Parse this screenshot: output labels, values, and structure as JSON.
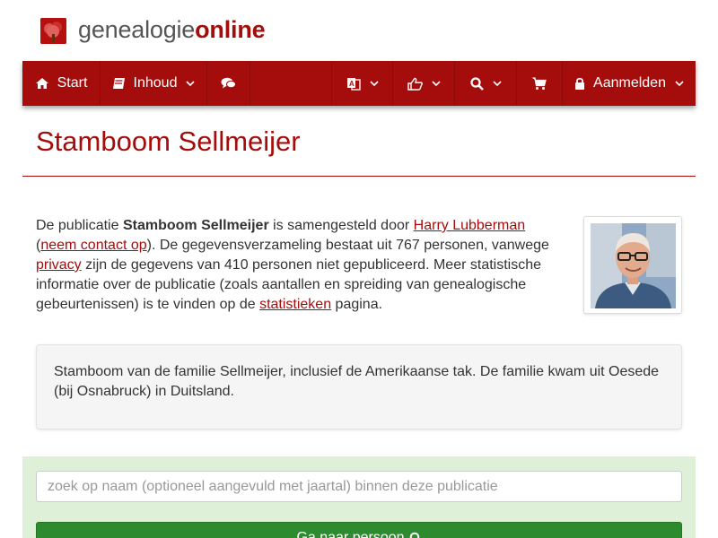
{
  "brand": {
    "logo_light": "genealogie",
    "logo_bold": "online"
  },
  "nav": {
    "start": "Start",
    "inhoud": "Inhoud",
    "aanmelden": "Aanmelden"
  },
  "page": {
    "title": "Stamboom Sellmeijer"
  },
  "intro": {
    "p1": "De publicatie ",
    "pub_name": "Stamboom Sellmeijer",
    "p2": " is samengesteld door ",
    "author_link": "Harry Lubberman",
    "p3": "(",
    "contact_link": "neem contact op",
    "p4": "). De gegevensverzameling bestaat uit 767 personen, vanwege ",
    "privacy_link": "privacy",
    "p5": " zijn de gegevens van 410 personen niet gepubliceerd. Meer statistische informatie over de publicatie (zoals aantallen en spreiding van genealogische gebeurtenissen) is te vinden op de ",
    "stats_link": "statistieken",
    "p6": " pagina."
  },
  "description": "Stamboom van de familie Sellmeijer, inclusief de Amerikaanse tak. De familie kwam uit Oesede (bij Osnabruck) in Duitsland.",
  "search": {
    "placeholder": "zoek op naam (optioneel aangevuld met jaartal) binnen deze publicatie",
    "button_label": "Ga naar persoon"
  },
  "colors": {
    "brand_red": "#a50d0d",
    "search_bg": "#dff0d8",
    "button_green": "#2e8a2e"
  },
  "icons": [
    "tree-logo-icon",
    "home-icon",
    "book-icon",
    "comments-icon",
    "translate-icon",
    "thumbs-up-icon",
    "search-icon",
    "cart-icon",
    "lock-icon",
    "chevron-down-icon"
  ]
}
